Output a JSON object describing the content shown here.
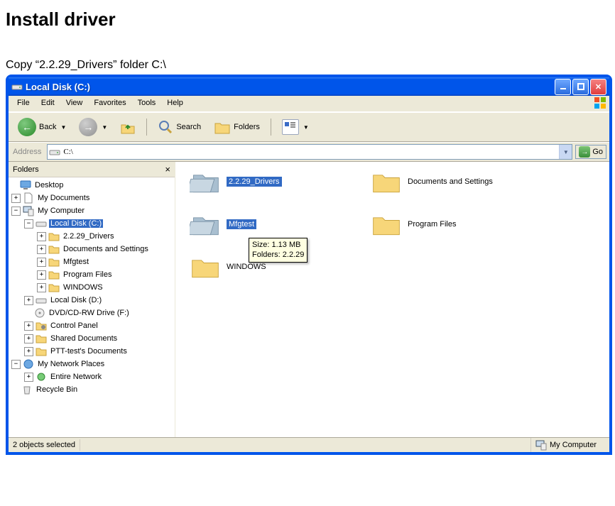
{
  "doc": {
    "heading": "Install driver",
    "instruction": "Copy “2.2.29_Drivers” folder C:\\"
  },
  "window": {
    "title": "Local Disk (C:)",
    "menu": {
      "file": "File",
      "edit": "Edit",
      "view": "View",
      "favorites": "Favorites",
      "tools": "Tools",
      "help": "Help"
    },
    "toolbar": {
      "back": "Back",
      "search": "Search",
      "folders": "Folders"
    },
    "address": {
      "label": "Address",
      "value": "C:\\",
      "go": "Go"
    },
    "sidebar": {
      "title": "Folders",
      "tree": {
        "desktop": "Desktop",
        "mydocs": "My Documents",
        "mycomp": "My Computer",
        "localc": "Local Disk (C:)",
        "f_drivers": "2.2.29_Drivers",
        "f_docs": "Documents and Settings",
        "f_mfg": "Mfgtest",
        "f_prog": "Program Files",
        "f_win": "WINDOWS",
        "locald": "Local Disk (D:)",
        "dvd": "DVD/CD-RW Drive (F:)",
        "cpanel": "Control Panel",
        "shared": "Shared Documents",
        "ptt": "PTT-test's Documents",
        "netplaces": "My Network Places",
        "entire": "Entire Network",
        "recycle": "Recycle Bin"
      }
    },
    "content": {
      "drivers": "2.2.29_Drivers",
      "docs": "Documents and Settings",
      "mfg": "Mfgtest",
      "prog": "Program Files",
      "win": "WINDOWS"
    },
    "tooltip": {
      "line1": "Size: 1.13 MB",
      "line2": "Folders: 2.2.29"
    },
    "status": {
      "left": "2 objects selected",
      "right": "My Computer"
    }
  }
}
